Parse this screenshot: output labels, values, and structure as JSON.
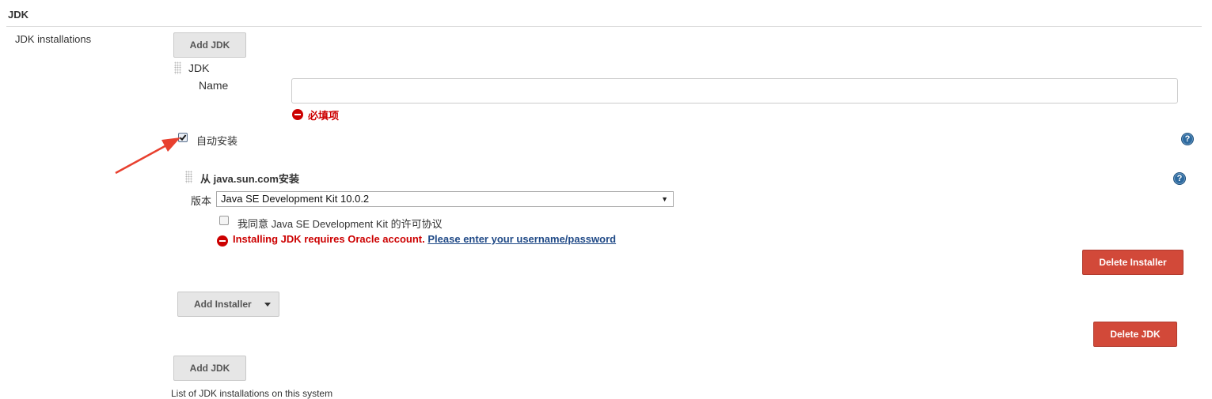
{
  "section": {
    "title": "JDK",
    "field_label": "JDK installations",
    "description": "List of JDK installations on this system"
  },
  "buttons": {
    "add_jdk_top": "Add JDK",
    "add_jdk_bottom": "Add JDK",
    "add_installer": "Add Installer",
    "delete_installer": "Delete Installer",
    "delete_jdk": "Delete JDK"
  },
  "jdk_item": {
    "header": "JDK",
    "name_label": "Name",
    "name_value": "",
    "name_error": "必填项",
    "auto_install_label": "自动安装",
    "auto_install_checked": true
  },
  "installer": {
    "header": "从 java.sun.com安装",
    "version_label": "版本",
    "version_selected": "Java SE Development Kit 10.0.2",
    "license_label": "我同意 Java SE Development Kit 的许可协议",
    "license_checked": false,
    "error_text": "Installing JDK requires Oracle account.",
    "error_link": "Please enter your username/password"
  },
  "icons": {
    "help": "question-mark",
    "error": "minus-circle",
    "annotation": "red-arrow"
  },
  "colors": {
    "error_red": "#cc0000",
    "delete_button": "#d24939",
    "help_icon": "#2e6a9f",
    "link": "#204a87"
  }
}
